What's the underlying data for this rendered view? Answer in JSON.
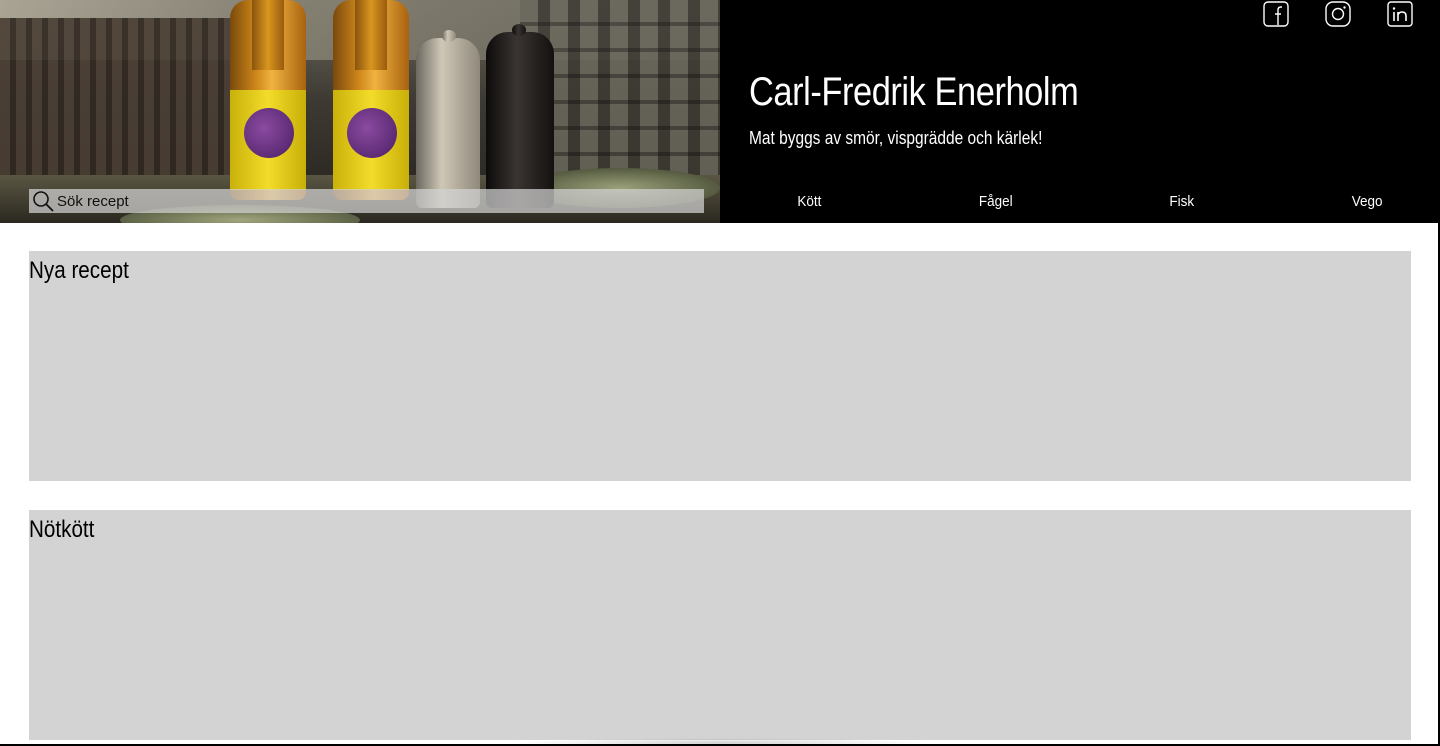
{
  "header": {
    "title": "Carl-Fredrik Enerholm",
    "tagline": "Mat byggs av smör, vispgrädde och kärlek!",
    "search": {
      "placeholder": "Sök recept",
      "icon": "search-icon"
    },
    "social": [
      {
        "name": "facebook",
        "icon": "facebook-icon"
      },
      {
        "name": "instagram",
        "icon": "instagram-icon"
      },
      {
        "name": "linkedin",
        "icon": "linkedin-icon"
      }
    ],
    "nav": [
      {
        "label": "Kött"
      },
      {
        "label": "Fågel"
      },
      {
        "label": "Fisk"
      },
      {
        "label": "Vego"
      }
    ]
  },
  "sections": [
    {
      "title": "Nya recept"
    },
    {
      "title": "Nötkött"
    }
  ],
  "colors": {
    "header_bg": "#000000",
    "section_bg": "#d3d3d3",
    "page_bg": "#ffffff",
    "text_light": "#ffffff",
    "text_dark": "#000000"
  }
}
